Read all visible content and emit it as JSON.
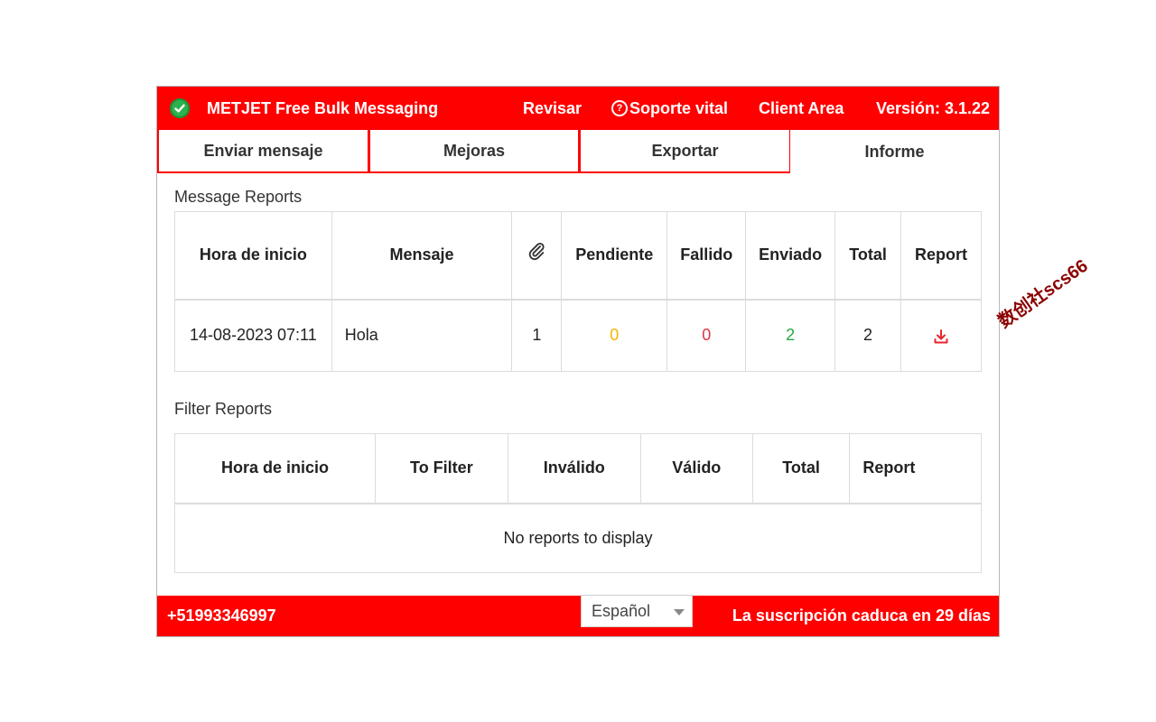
{
  "header": {
    "brand": "METJET Free Bulk Messaging",
    "links": [
      {
        "id": "review",
        "label": "Revisar"
      },
      {
        "id": "support",
        "label": "Soporte vital"
      },
      {
        "id": "client",
        "label": "Client Area"
      }
    ],
    "version": "Versión: 3.1.22"
  },
  "tabs": [
    {
      "label": "Enviar mensaje",
      "active": false
    },
    {
      "label": "Mejoras",
      "active": false
    },
    {
      "label": "Exportar",
      "active": false
    },
    {
      "label": "Informe",
      "active": true
    }
  ],
  "message_reports": {
    "title": "Message Reports",
    "columns": {
      "start": "Hora de inicio",
      "message": "Mensaje",
      "pending": "Pendiente",
      "failed": "Fallido",
      "sent": "Enviado",
      "total": "Total",
      "report": "Report"
    },
    "rows": [
      {
        "start": "14-08-2023 07:11",
        "message": "Hola",
        "attachments": "1",
        "pending": "0",
        "failed": "0",
        "sent": "2",
        "total": "2"
      }
    ]
  },
  "filter_reports": {
    "title": "Filter Reports",
    "columns": {
      "start": "Hora de inicio",
      "to_filter": "To Filter",
      "invalid": "Inválido",
      "valid": "Válido",
      "total": "Total",
      "report": "Report"
    },
    "empty_message": "No reports to display"
  },
  "footer": {
    "phone": "+51993346997",
    "language": "Español",
    "expiry": "La suscripción caduca en 29 días"
  },
  "watermark": "数创社scs66",
  "colors": {
    "brand_red": "#ff0000",
    "pending": "#f4b400",
    "failed": "#dc3545",
    "sent": "#28a745"
  }
}
